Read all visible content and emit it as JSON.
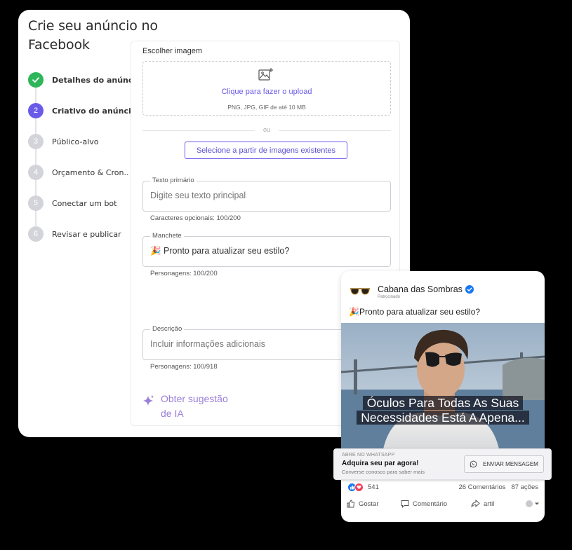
{
  "form": {
    "title": "Crie seu anúncio no Facebook",
    "steps": [
      {
        "num": "✓",
        "label": "Detalhes do anúncio",
        "state": "done"
      },
      {
        "num": "2",
        "label": "Criativo do anúncio",
        "state": "active"
      },
      {
        "num": "3",
        "label": "Público-alvo",
        "state": "pending"
      },
      {
        "num": "4",
        "label": "Orçamento & Cron..",
        "state": "pending"
      },
      {
        "num": "5",
        "label": "Conectar um bot",
        "state": "pending"
      },
      {
        "num": "6",
        "label": "Revisar e publicar",
        "state": "pending"
      }
    ],
    "image_label": "Escolher imagem",
    "upload_link": "Clique para fazer o upload",
    "upload_hint": "PNG, JPG, GIF de até 10 MB",
    "or": "ou",
    "select_existing": "Selecione a partir de imagens existentes",
    "primary_text": {
      "label": "Texto primário",
      "placeholder": "Digite seu texto principal",
      "hint": "Caracteres opcionais: 100/200"
    },
    "headline": {
      "label": "Manchete",
      "value": "🎉 Pronto para atualizar seu estilo?",
      "hint": "Personagens: 100/200"
    },
    "description": {
      "label": "Descrição",
      "placeholder": "Incluir informações adicionais",
      "hint": "Personagens: 100/918"
    },
    "ai_suggestion": "Obter sugestão de IA"
  },
  "preview": {
    "page_name": "Cabana das Sombras",
    "sponsored": "Patrocinado",
    "post_text": "🎉Pronto para atualizar seu estilo?",
    "overlay_line1": "Óculos Para Todas As Suas",
    "overlay_line2": "Necessidades Está A Apena...",
    "cta_small": "ABRE NO WHATSAPP",
    "cta_title": "Adquira seu par agora!",
    "cta_sub": "Converse conosco para saber mais",
    "cta_button": "ENVIAR MENSAGEM",
    "reaction_count": "541",
    "comments": "26 Comentários",
    "shares": "87 ações",
    "like": "Gostar",
    "comment": "Comentário",
    "share": "artil"
  },
  "colors": {
    "accent": "#6a5ae8",
    "done": "#2fb55a",
    "ai": "#9b7fd8",
    "fb_blue": "#1877f2"
  }
}
